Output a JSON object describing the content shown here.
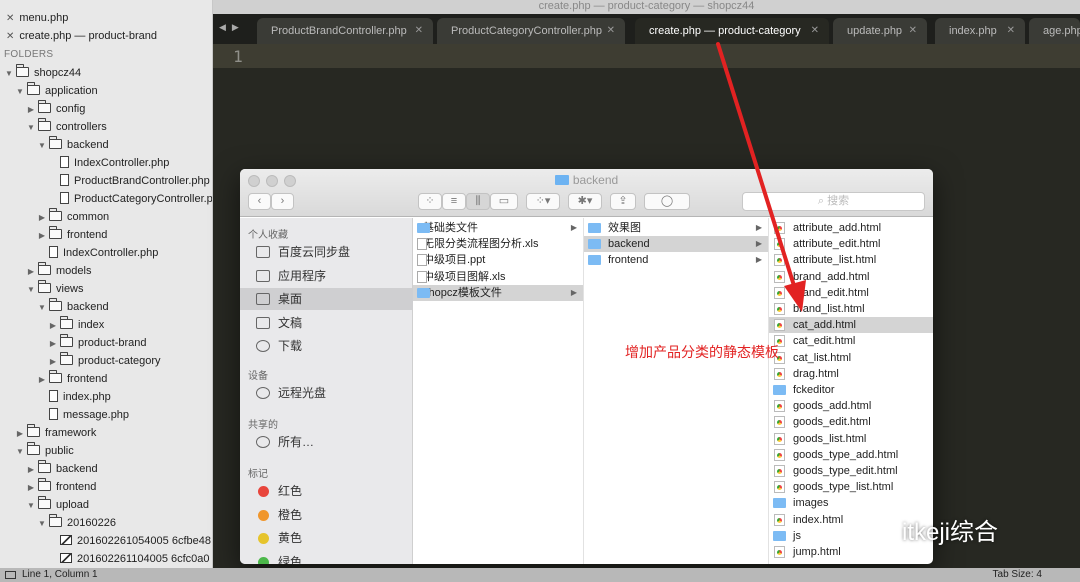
{
  "window_title": "create.php — product-category — shopcz44",
  "sidebar": {
    "open_files": [
      "menu.php",
      "create.php — product-brand"
    ],
    "folders_label": "FOLDERS",
    "tree": [
      {
        "label": "shopcz44",
        "depth": 0,
        "kind": "folder",
        "open": true
      },
      {
        "label": "application",
        "depth": 1,
        "kind": "folder",
        "open": true
      },
      {
        "label": "config",
        "depth": 2,
        "kind": "folder",
        "open": false
      },
      {
        "label": "controllers",
        "depth": 2,
        "kind": "folder",
        "open": true
      },
      {
        "label": "backend",
        "depth": 3,
        "kind": "folder",
        "open": true
      },
      {
        "label": "IndexController.php",
        "depth": 4,
        "kind": "file"
      },
      {
        "label": "ProductBrandController.php",
        "depth": 4,
        "kind": "file"
      },
      {
        "label": "ProductCategoryController.php",
        "depth": 4,
        "kind": "file"
      },
      {
        "label": "common",
        "depth": 3,
        "kind": "folder",
        "open": false
      },
      {
        "label": "frontend",
        "depth": 3,
        "kind": "folder",
        "open": false
      },
      {
        "label": "IndexController.php",
        "depth": 3,
        "kind": "file"
      },
      {
        "label": "models",
        "depth": 2,
        "kind": "folder",
        "open": false
      },
      {
        "label": "views",
        "depth": 2,
        "kind": "folder",
        "open": true
      },
      {
        "label": "backend",
        "depth": 3,
        "kind": "folder",
        "open": true
      },
      {
        "label": "index",
        "depth": 4,
        "kind": "folder",
        "open": false
      },
      {
        "label": "product-brand",
        "depth": 4,
        "kind": "folder",
        "open": false
      },
      {
        "label": "product-category",
        "depth": 4,
        "kind": "folder",
        "open": false
      },
      {
        "label": "frontend",
        "depth": 3,
        "kind": "folder",
        "open": false
      },
      {
        "label": "index.php",
        "depth": 3,
        "kind": "file"
      },
      {
        "label": "message.php",
        "depth": 3,
        "kind": "file"
      },
      {
        "label": "framework",
        "depth": 1,
        "kind": "folder",
        "open": false
      },
      {
        "label": "public",
        "depth": 1,
        "kind": "folder",
        "open": true
      },
      {
        "label": "backend",
        "depth": 2,
        "kind": "folder",
        "open": false
      },
      {
        "label": "frontend",
        "depth": 2,
        "kind": "folder",
        "open": false
      },
      {
        "label": "upload",
        "depth": 2,
        "kind": "folder",
        "open": true
      },
      {
        "label": "20160226",
        "depth": 3,
        "kind": "folder",
        "open": true
      },
      {
        "label": "201602261054005 6cfbe48",
        "depth": 4,
        "kind": "image"
      },
      {
        "label": "201602261104005 6cfc0a0",
        "depth": 4,
        "kind": "image"
      }
    ]
  },
  "tabs": [
    {
      "label": "ProductBrandController.php",
      "active": false
    },
    {
      "label": "ProductCategoryController.php",
      "active": false
    },
    {
      "label": "create.php — product-category",
      "active": true
    },
    {
      "label": "update.php",
      "active": false
    },
    {
      "label": "index.php",
      "active": false
    },
    {
      "label": "age.php",
      "active": false
    }
  ],
  "editor": {
    "line_number": "1"
  },
  "status_bar": {
    "position": "Line 1, Column 1",
    "tab_size": "Tab Size: 4"
  },
  "finder": {
    "title": "backend",
    "search_placeholder": "搜索",
    "sidebar": {
      "favorites_header": "个人收藏",
      "favorites": [
        {
          "label": "百度云同步盘",
          "icon": "folder-icon"
        },
        {
          "label": "应用程序",
          "icon": "applications-icon"
        },
        {
          "label": "桌面",
          "icon": "desktop-icon",
          "selected": true
        },
        {
          "label": "文稿",
          "icon": "documents-icon"
        },
        {
          "label": "下载",
          "icon": "download-icon"
        }
      ],
      "devices_header": "设备",
      "devices": [
        {
          "label": "远程光盘",
          "icon": "disc-icon"
        }
      ],
      "shared_header": "共享的",
      "shared": [
        {
          "label": "所有…",
          "icon": "network-icon"
        }
      ],
      "tags_header": "标记",
      "tags": [
        {
          "label": "红色",
          "color": "#e8453c"
        },
        {
          "label": "橙色",
          "color": "#f0962c"
        },
        {
          "label": "黄色",
          "color": "#e6c42c"
        },
        {
          "label": "绿色",
          "color": "#4cb84a"
        }
      ]
    },
    "column1": [
      {
        "label": "基础类文件",
        "kind": "folder",
        "has_children": true
      },
      {
        "label": "无限分类流程图分析.xls",
        "kind": "doc"
      },
      {
        "label": "中级项目.ppt",
        "kind": "doc"
      },
      {
        "label": "中级项目图解.xls",
        "kind": "doc"
      },
      {
        "label": "shopcz模板文件",
        "kind": "folder",
        "has_children": true,
        "selected": true
      }
    ],
    "column2": [
      {
        "label": "效果图",
        "kind": "folder",
        "has_children": true
      },
      {
        "label": "backend",
        "kind": "folder",
        "has_children": true,
        "selected": true
      },
      {
        "label": "frontend",
        "kind": "folder",
        "has_children": true
      }
    ],
    "column3": [
      {
        "label": "attribute_add.html",
        "kind": "html"
      },
      {
        "label": "attribute_edit.html",
        "kind": "html"
      },
      {
        "label": "attribute_list.html",
        "kind": "html"
      },
      {
        "label": "brand_add.html",
        "kind": "html"
      },
      {
        "label": "brand_edit.html",
        "kind": "html"
      },
      {
        "label": "brand_list.html",
        "kind": "html"
      },
      {
        "label": "cat_add.html",
        "kind": "html",
        "selected": true
      },
      {
        "label": "cat_edit.html",
        "kind": "html"
      },
      {
        "label": "cat_list.html",
        "kind": "html"
      },
      {
        "label": "drag.html",
        "kind": "html"
      },
      {
        "label": "fckeditor",
        "kind": "folder"
      },
      {
        "label": "goods_add.html",
        "kind": "html"
      },
      {
        "label": "goods_edit.html",
        "kind": "html"
      },
      {
        "label": "goods_list.html",
        "kind": "html"
      },
      {
        "label": "goods_type_add.html",
        "kind": "html"
      },
      {
        "label": "goods_type_edit.html",
        "kind": "html"
      },
      {
        "label": "goods_type_list.html",
        "kind": "html"
      },
      {
        "label": "images",
        "kind": "folder"
      },
      {
        "label": "index.html",
        "kind": "html"
      },
      {
        "label": "js",
        "kind": "folder"
      },
      {
        "label": "jump.html",
        "kind": "html"
      }
    ]
  },
  "annotation": {
    "text": "增加产品分类的静态模板",
    "color": "#e22222"
  },
  "watermark": "itkeji综合"
}
